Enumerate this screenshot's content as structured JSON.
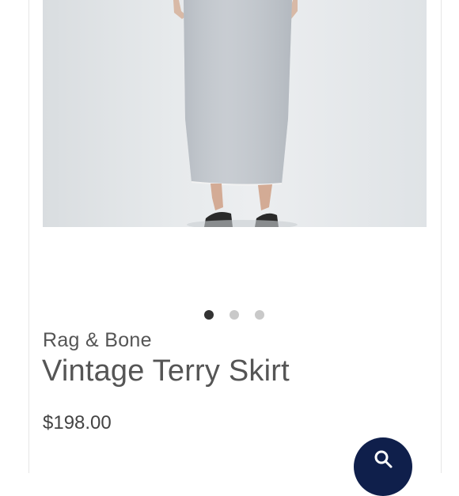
{
  "product": {
    "brand": "Rag & Bone",
    "title": "Vintage Terry Skirt",
    "price": "$198.00"
  },
  "carousel": {
    "total_slides": 3,
    "active_index": 0
  },
  "colors": {
    "dot_active": "#333333",
    "dot_inactive": "#c9c9c9",
    "fab_background": "#0f1f4b",
    "text": "#555555"
  },
  "icons": {
    "fab_icon": "search-icon"
  }
}
